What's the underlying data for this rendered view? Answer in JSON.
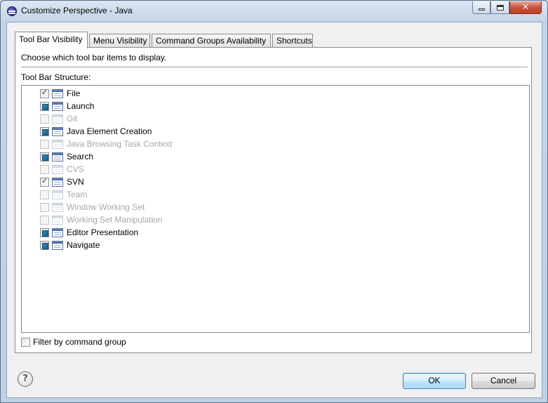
{
  "window": {
    "title": "Customize Perspective - Java",
    "controls": {
      "minimize": "minimize",
      "maximize": "maximize",
      "close": "✕"
    }
  },
  "tabs": [
    {
      "label": "Tool Bar Visibility",
      "active": true
    },
    {
      "label": "Menu Visibility",
      "active": false
    },
    {
      "label": "Command Groups Availability",
      "active": false
    },
    {
      "label": "Shortcuts",
      "active": false
    }
  ],
  "panel": {
    "description": "Choose which tool bar items to display.",
    "structure_label": "Tool Bar Structure:",
    "items": [
      {
        "label": "File",
        "state": "checked",
        "enabled": true
      },
      {
        "label": "Launch",
        "state": "partial",
        "enabled": true
      },
      {
        "label": "Git",
        "state": "unchecked",
        "enabled": false
      },
      {
        "label": "Java Element Creation",
        "state": "partial",
        "enabled": true
      },
      {
        "label": "Java Browsing Task Context",
        "state": "unchecked",
        "enabled": false
      },
      {
        "label": "Search",
        "state": "partial",
        "enabled": true
      },
      {
        "label": "CVS",
        "state": "unchecked",
        "enabled": false
      },
      {
        "label": "SVN",
        "state": "checked",
        "enabled": true
      },
      {
        "label": "Team",
        "state": "unchecked",
        "enabled": false
      },
      {
        "label": "Window Working Set",
        "state": "unchecked",
        "enabled": false
      },
      {
        "label": "Working Set Manipulation",
        "state": "unchecked",
        "enabled": false
      },
      {
        "label": "Editor Presentation",
        "state": "partial",
        "enabled": true
      },
      {
        "label": "Navigate",
        "state": "partial",
        "enabled": true
      }
    ],
    "filter_label": "Filter by command group",
    "filter_checked": false
  },
  "footer": {
    "help_icon": "?",
    "ok_label": "OK",
    "cancel_label": "Cancel"
  },
  "colors": {
    "titlebar": "#c4d4e7",
    "dialog_bg": "#f0f0f0",
    "disabled_text": "#a7a7a7",
    "ok_button": "#bee6fd",
    "partial_check": "#1a5f8c"
  }
}
